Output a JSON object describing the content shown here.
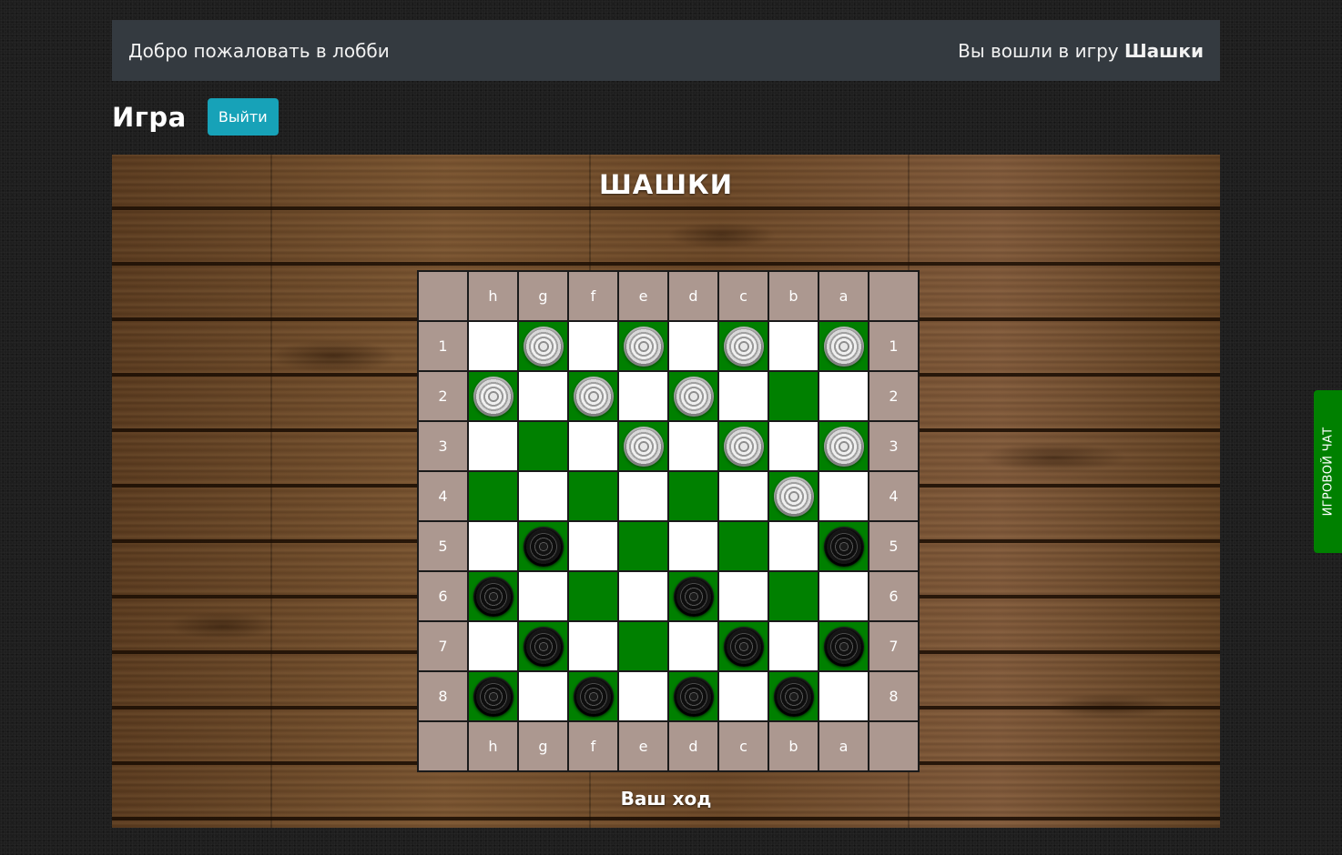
{
  "topbar": {
    "welcome": "Добро пожаловать в лобби",
    "entered_prefix": "Вы вошли в игру ",
    "game_name": "Шашки"
  },
  "game": {
    "title": "Игра",
    "exit_label": "Выйти"
  },
  "board": {
    "title": "ШАШКИ",
    "files": [
      "h",
      "g",
      "f",
      "e",
      "d",
      "c",
      "b",
      "a"
    ],
    "ranks": [
      "1",
      "2",
      "3",
      "4",
      "5",
      "6",
      "7",
      "8"
    ],
    "squares": [
      [
        "light",
        "dark",
        "light",
        "dark",
        "light",
        "dark",
        "light",
        "dark"
      ],
      [
        "dark",
        "light",
        "dark",
        "light",
        "dark",
        "light",
        "dark",
        "light"
      ],
      [
        "light",
        "dark",
        "light",
        "dark",
        "light",
        "dark",
        "light",
        "dark"
      ],
      [
        "dark",
        "light",
        "dark",
        "light",
        "dark",
        "light",
        "dark",
        "light"
      ],
      [
        "light",
        "dark",
        "light",
        "dark",
        "light",
        "dark",
        "light",
        "dark"
      ],
      [
        "dark",
        "light",
        "dark",
        "light",
        "dark",
        "light",
        "dark",
        "light"
      ],
      [
        "light",
        "dark",
        "light",
        "dark",
        "light",
        "dark",
        "light",
        "dark"
      ],
      [
        "dark",
        "light",
        "dark",
        "light",
        "dark",
        "light",
        "dark",
        "light"
      ]
    ],
    "pieces": [
      [
        "",
        "white",
        "",
        "white",
        "",
        "white",
        "",
        "white"
      ],
      [
        "white",
        "",
        "white",
        "",
        "white",
        "",
        "",
        ""
      ],
      [
        "",
        "",
        "",
        "white",
        "",
        "white",
        "",
        "white"
      ],
      [
        "",
        "",
        "",
        "",
        "",
        "",
        "white",
        ""
      ],
      [
        "",
        "black",
        "",
        "",
        "",
        "",
        "",
        "black"
      ],
      [
        "black",
        "",
        "",
        "",
        "black",
        "",
        "",
        ""
      ],
      [
        "",
        "black",
        "",
        "",
        "",
        "black",
        "",
        "black"
      ],
      [
        "black",
        "",
        "black",
        "",
        "black",
        "",
        "black",
        ""
      ]
    ],
    "colors": {
      "dark": "#008000",
      "light": "#ffffff",
      "label": "#ac9890"
    },
    "turn_status": "Ваш ход"
  },
  "chat": {
    "tab_label": "ИГРОВОЙ ЧАТ"
  }
}
